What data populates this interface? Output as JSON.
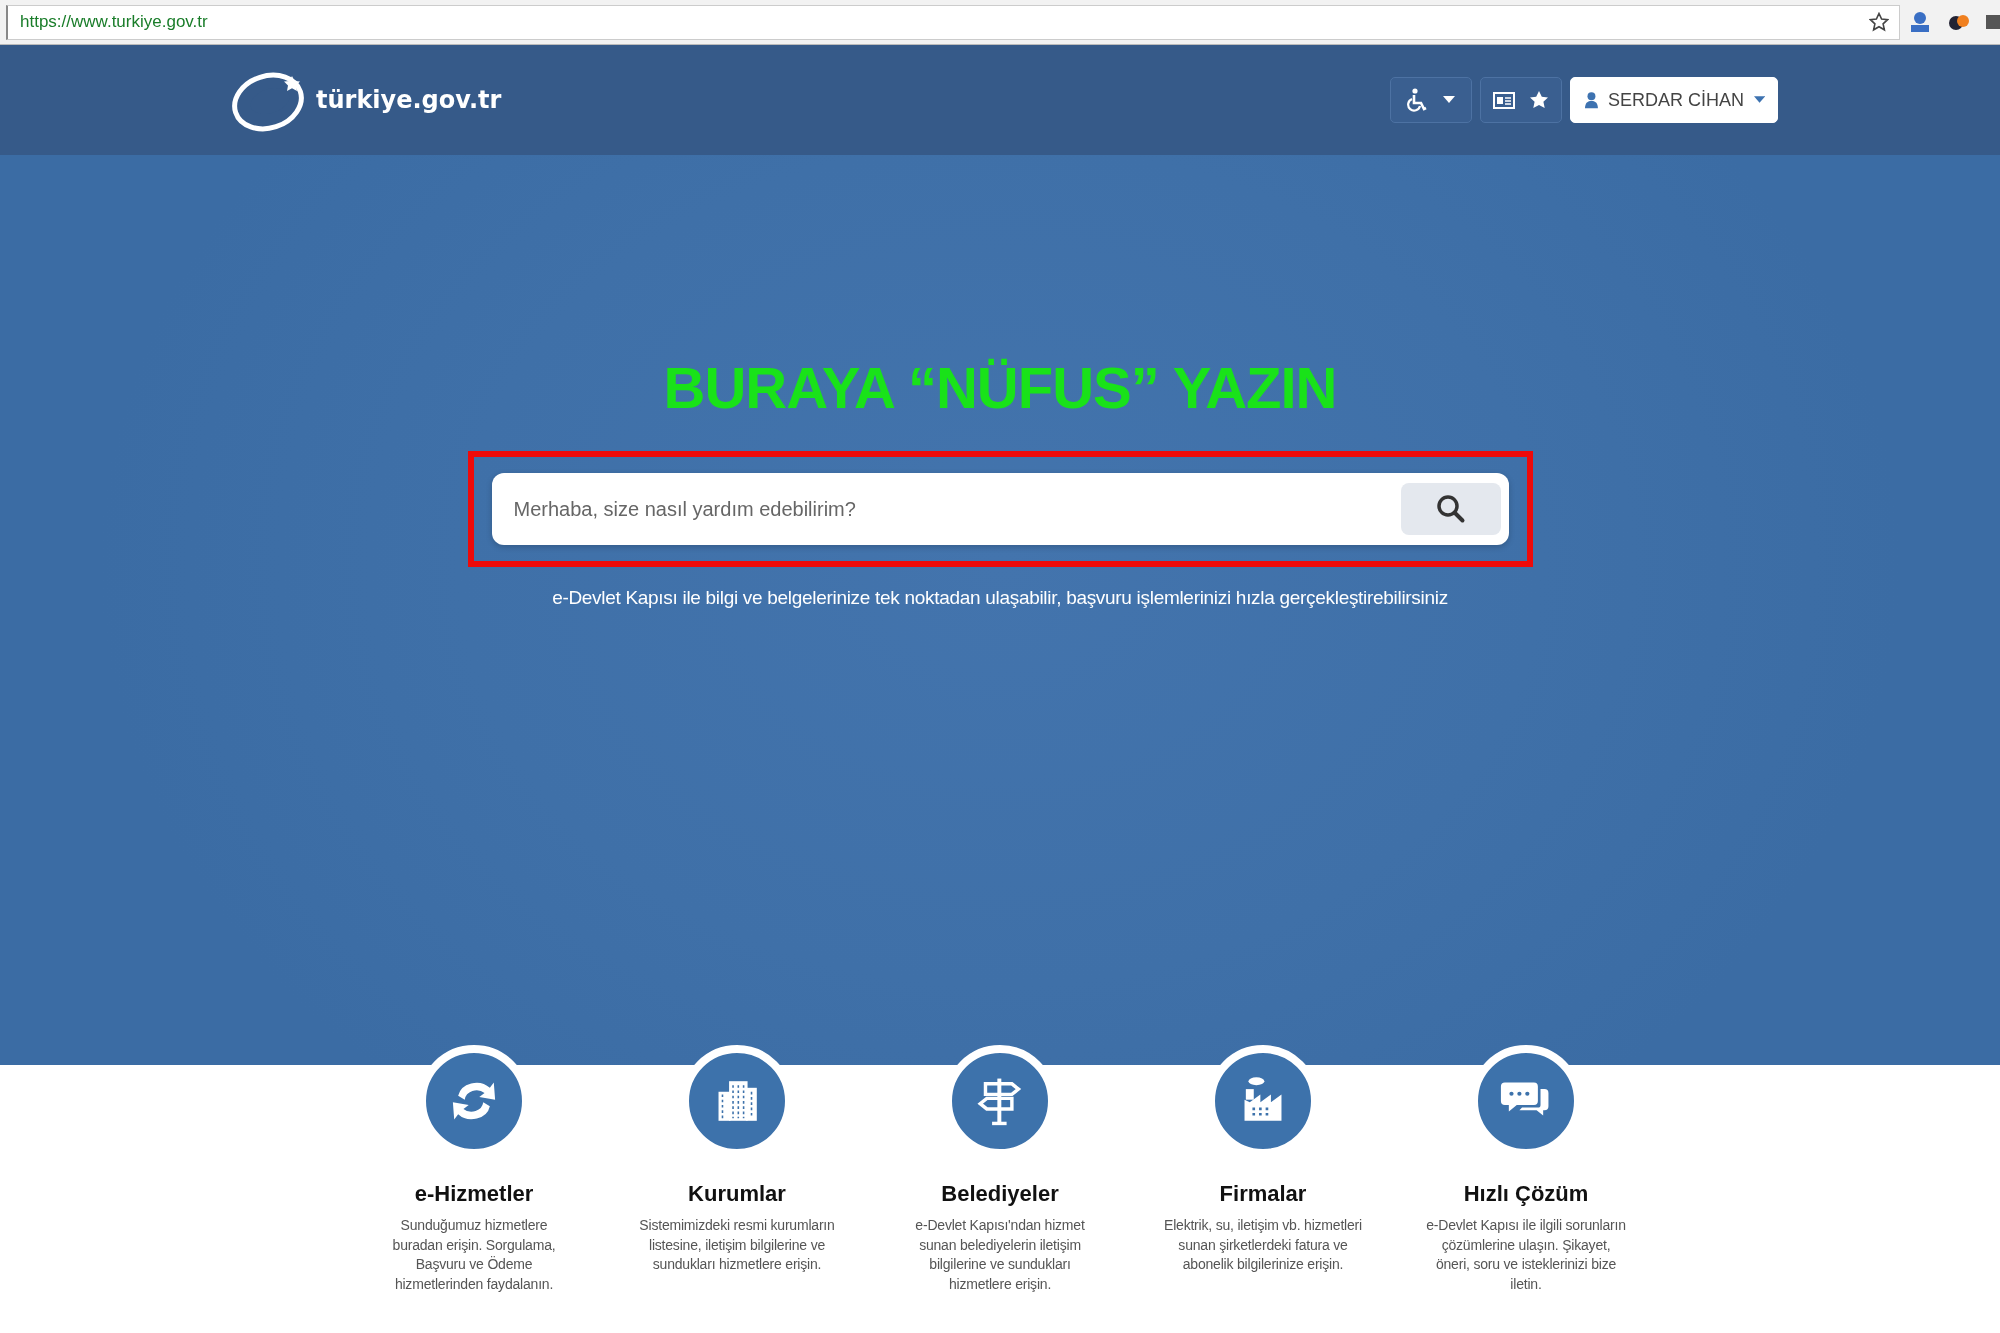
{
  "browser": {
    "url": "https://www.turkiye.gov.tr"
  },
  "header": {
    "logo_text": "türkiye.gov.tr",
    "user_name": "SERDAR CİHAN"
  },
  "hero": {
    "annotation": "BURAYA “NÜFUS” YAZIN",
    "search": {
      "placeholder": "Merhaba, size nasıl yardım edebilirim?"
    },
    "tagline": "e-Devlet Kapısı ile bilgi ve belgelerinize tek noktadan ulaşabilir, başvuru işlemlerinizi hızla gerçekleştirebilirsiniz"
  },
  "services": [
    {
      "kind": "refresh",
      "title": "e-Hizmetler",
      "description": "Sunduğumuz hizmetlere buradan erişin. Sorgulama, Başvuru ve Ödeme hizmetlerinden faydalanın."
    },
    {
      "kind": "buildings",
      "title": "Kurumlar",
      "description": "Sistemimizdeki resmi kurumların listesine, iletişim bilgilerine ve sundukları hizmetlere erişin."
    },
    {
      "kind": "signpost",
      "title": "Belediyeler",
      "description": "e-Devlet Kapısı'ndan hizmet sunan belediyelerin iletişim bilgilerine ve sundukları hizmetlere erişin."
    },
    {
      "kind": "factory",
      "title": "Firmalar",
      "description": "Elektrik, su, iletişim vb. hizmetleri sunan şirketlerdeki fatura ve abonelik bilgilerinize erişin."
    },
    {
      "kind": "chat",
      "title": "Hızlı Çözüm",
      "description": "e-Devlet Kapısı ile ilgili sorunların çözümlerine ulaşın. Şikayet, öneri, soru ve isteklerinizi bize iletin."
    }
  ]
}
